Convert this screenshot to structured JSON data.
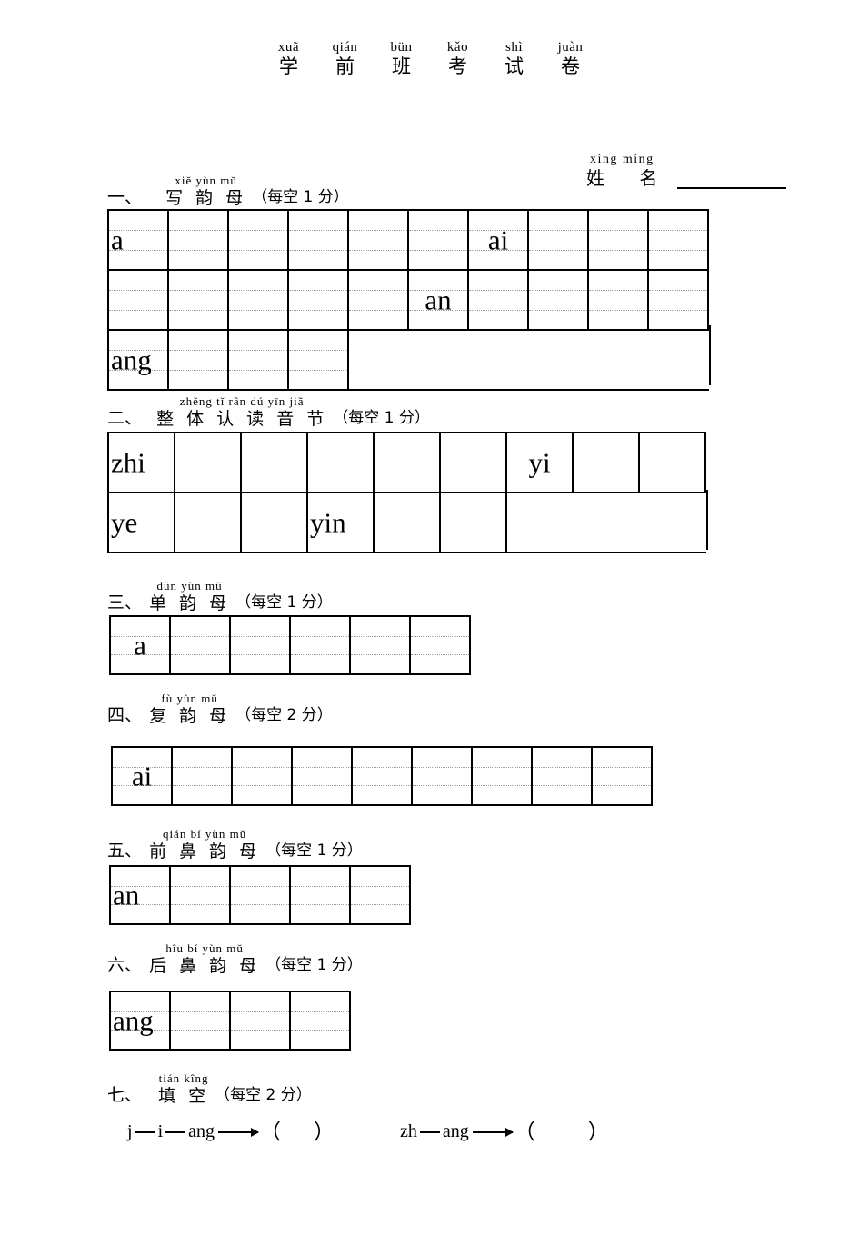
{
  "title": {
    "chars": [
      {
        "pinyin": "xuã",
        "hanzi": "学"
      },
      {
        "pinyin": "qián",
        "hanzi": "前"
      },
      {
        "pinyin": "bün",
        "hanzi": "班"
      },
      {
        "pinyin": "kǎo",
        "hanzi": "考"
      },
      {
        "pinyin": "shì",
        "hanzi": "试"
      },
      {
        "pinyin": "juàn",
        "hanzi": "卷"
      }
    ]
  },
  "name_field": {
    "pinyin": "xìng míng",
    "label": "姓 名",
    "value": ""
  },
  "sections": [
    {
      "number": "一、",
      "pinyin": "xiě yùn mǔ",
      "label": "写 韵 母",
      "points": "（每空 1 分）"
    },
    {
      "number": "二、",
      "pinyin": "zhěng tǐ rân dú yīn jiã",
      "label": "整 体 认 读 音 节",
      "points": "（每空 1 分）"
    },
    {
      "number": "三、",
      "pinyin": "dün yùn mǔ",
      "label": "单 韵 母",
      "points": "（每空 1 分）"
    },
    {
      "number": "四、",
      "pinyin": "fù yùn mǔ",
      "label": "复 韵 母",
      "points": "（每空 2 分）"
    },
    {
      "number": "五、",
      "pinyin": "qián bí yùn mǔ",
      "label": "前 鼻 韵 母",
      "points": "（每空 1 分）"
    },
    {
      "number": "六、",
      "pinyin": "hîu bí yùn mǔ",
      "label": "后 鼻 韵 母",
      "points": "（每空 1 分）"
    },
    {
      "number": "七、",
      "pinyin": "tián kîng",
      "label": "填 空",
      "points": "（每空 2 分）"
    }
  ],
  "tables": {
    "t1": {
      "rows": [
        [
          "a",
          "",
          "",
          "",
          "",
          "",
          "ai",
          "",
          "",
          ""
        ],
        [
          "",
          "",
          "",
          "",
          "",
          "an",
          "",
          "",
          "",
          ""
        ],
        [
          "ang",
          "",
          "",
          ""
        ]
      ]
    },
    "t2": {
      "rows": [
        [
          "zhi",
          "",
          "",
          "",
          "",
          "",
          "yi",
          "",
          ""
        ],
        [
          "ye",
          "",
          "",
          "yin",
          "",
          ""
        ]
      ]
    },
    "t3": {
      "rows": [
        [
          "a",
          "",
          "",
          "",
          "",
          ""
        ]
      ]
    },
    "t4": {
      "rows": [
        [
          "ai",
          "",
          "",
          "",
          "",
          "",
          "",
          "",
          ""
        ]
      ]
    },
    "t5": {
      "rows": [
        [
          "an",
          "",
          "",
          "",
          ""
        ]
      ]
    },
    "t6": {
      "rows": [
        [
          "ang",
          "",
          "",
          ""
        ]
      ]
    }
  },
  "fill_in": {
    "item1": {
      "part1": "j",
      "part2": "i",
      "part3": "ang",
      "answer": ""
    },
    "item2": {
      "part1": "zh",
      "part2": "ang",
      "answer": ""
    },
    "paren_open": "（",
    "paren_close": "）"
  },
  "colors": {
    "ink": "#000000",
    "guide_line": "#9a9a9a"
  }
}
